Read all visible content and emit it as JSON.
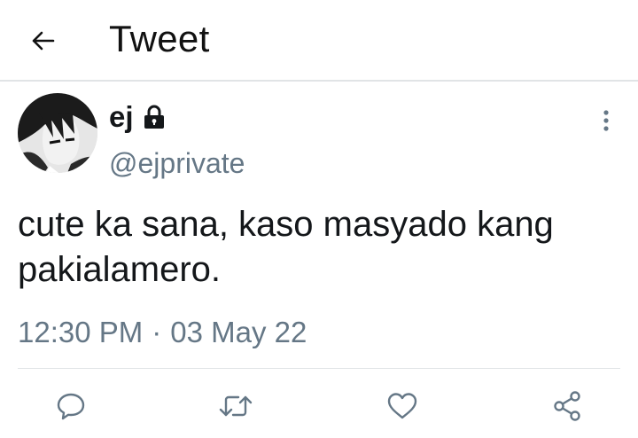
{
  "header": {
    "title": "Tweet",
    "back_icon": "arrow-left-icon"
  },
  "tweet": {
    "display_name": "ej",
    "protected_icon": "lock-icon",
    "handle": "@ejprivate",
    "text": "cute ka sana, kaso masyado kang pakialamero.",
    "time": "12:30 PM",
    "separator": "·",
    "date": "03 May 22",
    "more_icon": "vertical-dots-icon"
  },
  "actions": [
    {
      "name": "reply",
      "icon": "speech-bubble-icon"
    },
    {
      "name": "retweet",
      "icon": "retweet-arrows-icon"
    },
    {
      "name": "like",
      "icon": "heart-icon"
    },
    {
      "name": "share",
      "icon": "share-nodes-icon"
    }
  ],
  "colors": {
    "text": "#14171a",
    "secondary": "#657786",
    "divider": "#e1e4e6",
    "icon": "#657786"
  }
}
